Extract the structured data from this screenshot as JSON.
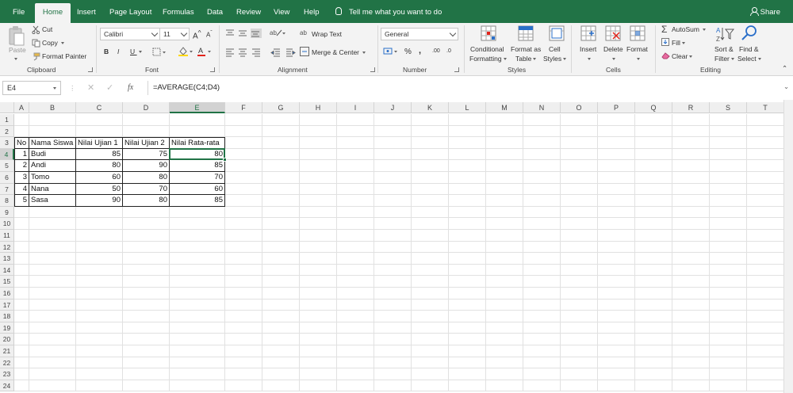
{
  "tabs": [
    "File",
    "Home",
    "Insert",
    "Page Layout",
    "Formulas",
    "Data",
    "Review",
    "View",
    "Help"
  ],
  "tell_me": "Tell me what you want to do",
  "share": "Share",
  "ribbon": {
    "clipboard": {
      "paste": "Paste",
      "cut": "Cut",
      "copy": "Copy",
      "format_painter": "Format Painter",
      "label": "Clipboard"
    },
    "font": {
      "name": "Calibri",
      "size": "11",
      "bold": "B",
      "italic": "I",
      "underline": "U",
      "grow": "A",
      "shrink": "A",
      "label": "Font"
    },
    "alignment": {
      "wrap_text": "Wrap Text",
      "merge_center": "Merge & Center",
      "label": "Alignment"
    },
    "number": {
      "format": "General",
      "percent": "%",
      "comma": ",",
      "inc_dec": ".00",
      "dec_dec": ".0",
      "label": "Number"
    },
    "styles": {
      "conditional_1": "Conditional",
      "conditional_2": "Formatting",
      "format_table_1": "Format as",
      "format_table_2": "Table",
      "cell_styles_1": "Cell",
      "cell_styles_2": "Styles",
      "label": "Styles"
    },
    "cells": {
      "insert": "Insert",
      "delete": "Delete",
      "format": "Format",
      "label": "Cells"
    },
    "editing": {
      "autosum": "AutoSum",
      "fill": "Fill",
      "clear": "Clear",
      "sort_1": "Sort &",
      "sort_2": "Filter",
      "find_1": "Find &",
      "find_2": "Select",
      "label": "Editing"
    }
  },
  "formula_bar": {
    "name_box": "E4",
    "fx": "fx",
    "formula": "=AVERAGE(C4;D4)"
  },
  "columns": [
    "A",
    "B",
    "C",
    "D",
    "E",
    "F",
    "G",
    "H",
    "I",
    "J",
    "K",
    "L",
    "M",
    "N",
    "O",
    "P",
    "Q",
    "R",
    "S",
    "T"
  ],
  "rows": [
    "1",
    "2",
    "3",
    "4",
    "5",
    "6",
    "7",
    "8",
    "9",
    "10",
    "11",
    "12",
    "13",
    "14",
    "15",
    "16",
    "17",
    "18",
    "19",
    "20",
    "21",
    "22",
    "23",
    "24"
  ],
  "table": {
    "headers": [
      "No",
      "Nama Siswa",
      "Nilai Ujian 1",
      "Nilai Ujian 2",
      "Nilai Rata-rata"
    ],
    "rows": [
      [
        "1",
        "Budi",
        "85",
        "75",
        "80"
      ],
      [
        "2",
        "Andi",
        "80",
        "90",
        "85"
      ],
      [
        "3",
        "Tomo",
        "60",
        "80",
        "70"
      ],
      [
        "4",
        "Nana",
        "50",
        "70",
        "60"
      ],
      [
        "5",
        "Sasa",
        "90",
        "80",
        "85"
      ]
    ]
  },
  "colors": {
    "accent": "#217346"
  }
}
